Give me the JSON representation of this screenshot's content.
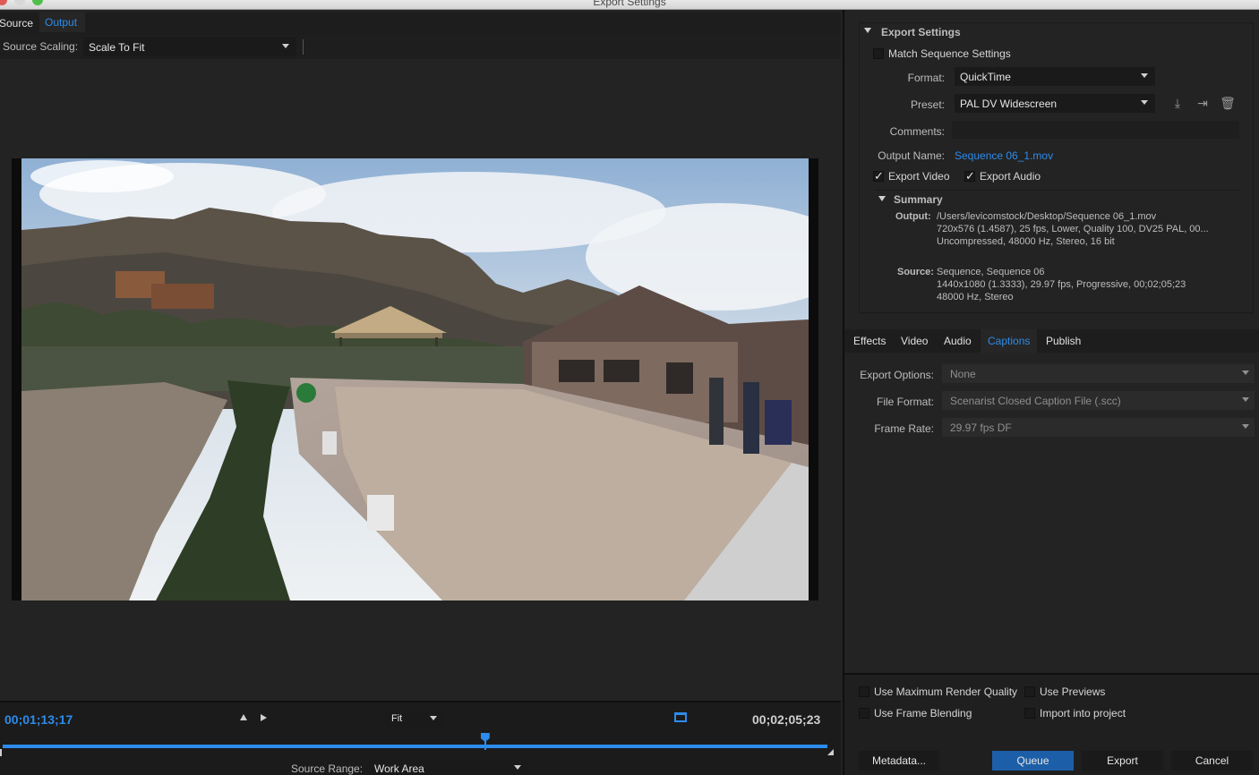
{
  "window": {
    "title": "Export Settings"
  },
  "left_tabs": {
    "source": "Source",
    "output": "Output"
  },
  "source_scaling": {
    "label": "Source Scaling:",
    "value": "Scale To Fit"
  },
  "timeline": {
    "current_time": "00;01;13;17",
    "duration": "00;02;05;23",
    "zoom": "Fit",
    "playhead_fraction": 0.585
  },
  "source_range": {
    "label": "Source Range:",
    "value": "Work Area"
  },
  "export_settings": {
    "header": "Export Settings",
    "match_sequence": "Match Sequence Settings",
    "format_label": "Format:",
    "format_value": "QuickTime",
    "preset_label": "Preset:",
    "preset_value": "PAL DV Widescreen",
    "comments_label": "Comments:",
    "output_name_label": "Output Name:",
    "output_name_value": "Sequence 06_1.mov",
    "export_video": "Export Video",
    "export_audio": "Export Audio",
    "summary_header": "Summary",
    "output_label": "Output:",
    "output_lines": [
      "/Users/levicomstock/Desktop/Sequence 06_1.mov",
      "720x576 (1.4587), 25 fps, Lower, Quality 100, DV25 PAL, 00...",
      "Uncompressed, 48000 Hz, Stereo, 16 bit"
    ],
    "source_label": "Source:",
    "source_lines": [
      "Sequence, Sequence 06",
      "1440x1080 (1.3333), 29.97 fps, Progressive, 00;02;05;23",
      "48000 Hz, Stereo"
    ]
  },
  "sub_tabs": [
    "Effects",
    "Video",
    "Audio",
    "Captions",
    "Publish"
  ],
  "captions": {
    "export_options_label": "Export Options:",
    "export_options_value": "None",
    "file_format_label": "File Format:",
    "file_format_value": "Scenarist Closed Caption File (.scc)",
    "frame_rate_label": "Frame Rate:",
    "frame_rate_value": "29.97 fps DF"
  },
  "bottom": {
    "max_render": "Use Maximum Render Quality",
    "use_previews": "Use Previews",
    "frame_blending": "Use Frame Blending",
    "import_project": "Import into project",
    "metadata": "Metadata...",
    "queue": "Queue",
    "export": "Export",
    "cancel": "Cancel"
  },
  "colors": {
    "accent": "#2d8ceb",
    "panel": "#232323",
    "primary_button": "#1c5fa8"
  }
}
